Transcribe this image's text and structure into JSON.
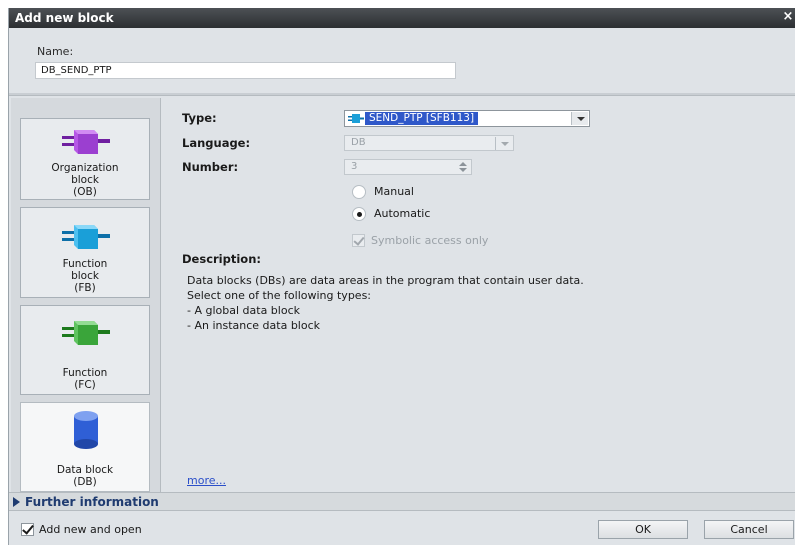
{
  "dialog": {
    "title": "Add new block",
    "close_glyph": "×"
  },
  "name": {
    "label": "Name:",
    "value": "DB_SEND_PTP"
  },
  "block_types": [
    {
      "line1": "Organization",
      "line2": "block",
      "line3": "(OB)",
      "icon": "organization-block-icon",
      "color": "#9b3fd0"
    },
    {
      "line1": "Function",
      "line2": "block",
      "line3": "(FB)",
      "icon": "function-block-icon",
      "color": "#1a9fd8"
    },
    {
      "line1": "Function",
      "line2": "(FC)",
      "icon": "function-icon",
      "color": "#3aa53a"
    },
    {
      "line1": "Data block",
      "line2": "(DB)",
      "icon": "data-block-icon",
      "color": "#2f5fd6",
      "selected": true
    }
  ],
  "form": {
    "type_label": "Type:",
    "type_value": "SEND_PTP [SFB113]",
    "language_label": "Language:",
    "language_value": "DB",
    "number_label": "Number:",
    "number_value": "3",
    "manual_label": "Manual",
    "automatic_label": "Automatic",
    "numbering_mode": "Automatic",
    "symbolic_label": "Symbolic access only",
    "symbolic_checked": true
  },
  "description": {
    "title": "Description:",
    "lines": [
      "Data blocks (DBs) are data areas in the program that contain user data.",
      "Select one of the following types:",
      "- A global data block",
      "- An instance data block"
    ],
    "more_link": "more..."
  },
  "further_info": {
    "label": "Further information"
  },
  "footer": {
    "add_open_label": "Add new and open",
    "add_open_checked": true,
    "ok_label": "OK",
    "cancel_label": "Cancel"
  }
}
